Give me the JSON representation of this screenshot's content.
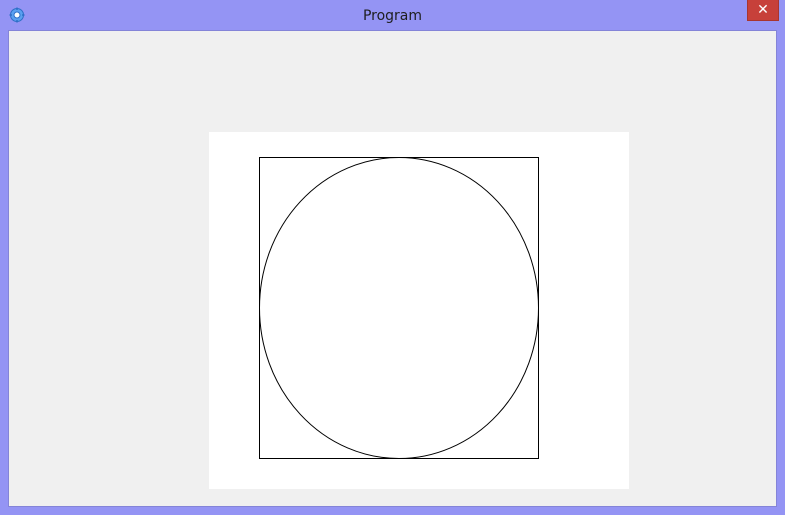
{
  "window": {
    "title": "Program",
    "close_label": "✕",
    "app_icon": "gear-icon",
    "frame_color": "#9494f4",
    "close_color": "#c7403a"
  },
  "canvas": {
    "background": "#ffffff",
    "shapes": [
      {
        "type": "rectangle",
        "name": "square"
      },
      {
        "type": "ellipse",
        "name": "circle"
      }
    ]
  }
}
